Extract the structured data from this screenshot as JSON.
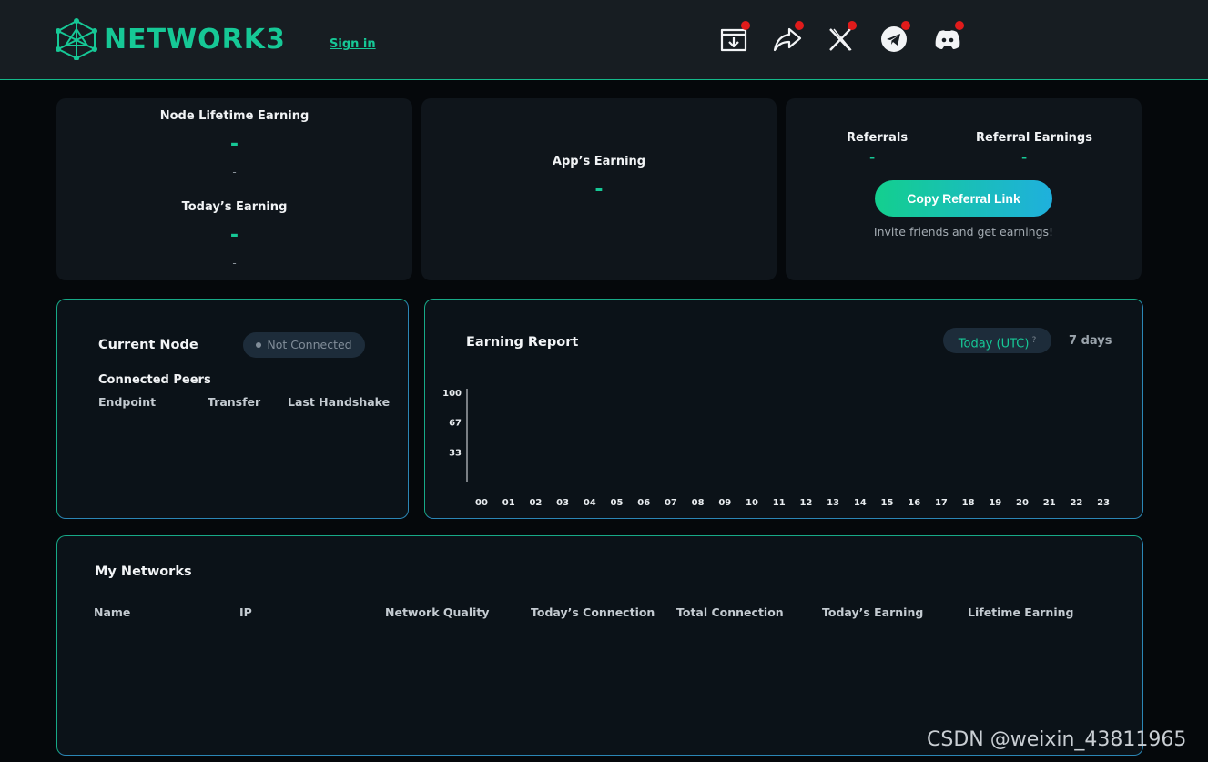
{
  "header": {
    "logo_text": "NETWORK3",
    "signin_label": "Sign in",
    "social_icons": [
      "download-icon",
      "share-icon",
      "x-icon",
      "telegram-icon",
      "discord-icon"
    ],
    "accent_color": "#16c896",
    "notification_dot_color": "#e01b1b"
  },
  "earnings": {
    "lifetime_label": "Node Lifetime Earning",
    "lifetime_value": "-",
    "lifetime_sub": "-",
    "today_label": "Today’s Earning",
    "today_value": "-",
    "today_sub": "-"
  },
  "app_earning": {
    "label": "App’s Earning",
    "value": "-",
    "sub": "-"
  },
  "referral": {
    "referrals_label": "Referrals",
    "referrals_value": "-",
    "earnings_label": "Referral Earnings",
    "earnings_value": "-",
    "copy_button": "Copy Referral Link",
    "invite_text": "Invite friends and get earnings!"
  },
  "current_node": {
    "title": "Current Node",
    "status": "Not Connected",
    "peers_label": "Connected Peers",
    "columns": [
      "Endpoint",
      "Transfer",
      "Last Handshake"
    ]
  },
  "earning_report": {
    "title": "Earning Report",
    "tab_today": "Today (UTC)",
    "tab_today_hint": "?",
    "tab_7days": "7 days"
  },
  "chart_data": {
    "type": "bar",
    "title": "Earning Report",
    "categories": [
      "00",
      "01",
      "02",
      "03",
      "04",
      "05",
      "06",
      "07",
      "08",
      "09",
      "10",
      "11",
      "12",
      "13",
      "14",
      "15",
      "16",
      "17",
      "18",
      "19",
      "20",
      "21",
      "22",
      "23"
    ],
    "values": [
      0,
      0,
      0,
      0,
      0,
      0,
      0,
      0,
      0,
      0,
      0,
      0,
      0,
      0,
      0,
      0,
      0,
      0,
      0,
      0,
      0,
      0,
      0,
      0
    ],
    "y_ticks": [
      "100",
      "67",
      "33"
    ],
    "ylim": [
      0,
      100
    ],
    "grid": false
  },
  "networks": {
    "title": "My Networks",
    "columns": [
      "Name",
      "IP",
      "Network Quality",
      "Today’s Connection",
      "Total Connection",
      "Today’s Earning",
      "Lifetime Earning"
    ],
    "rows": []
  },
  "watermark": "CSDN @weixin_43811965"
}
